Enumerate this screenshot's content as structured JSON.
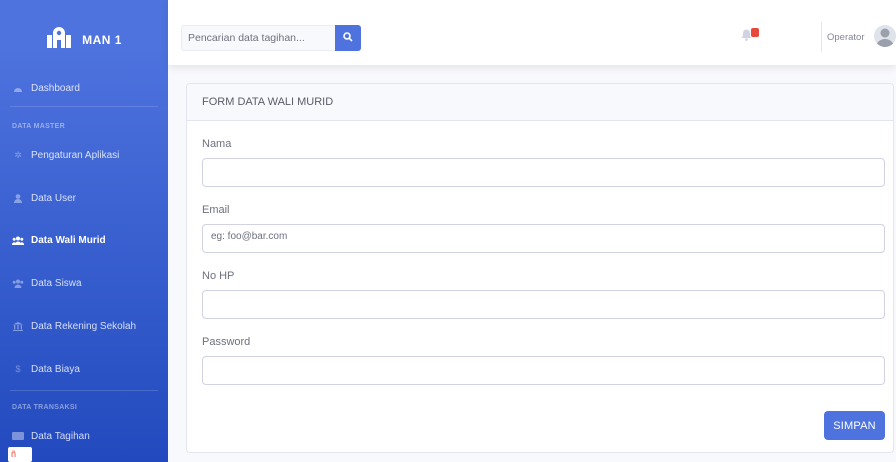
{
  "app": {
    "brand": "MAN 1"
  },
  "sidebar": {
    "dashboard": "Dashboard",
    "heading_master": "DATA MASTER",
    "items_master": [
      {
        "label": "Pengaturan Aplikasi",
        "icon": "gear-icon"
      },
      {
        "label": "Data User",
        "icon": "user-icon"
      },
      {
        "label": "Data Wali Murid",
        "icon": "users-icon",
        "active": true
      },
      {
        "label": "Data Siswa",
        "icon": "users-icon"
      },
      {
        "label": "Data Rekening Sekolah",
        "icon": "bank-icon"
      },
      {
        "label": "Data Biaya",
        "icon": "dollar-icon"
      }
    ],
    "heading_transaksi": "DATA TRANSAKSI",
    "items_transaksi": [
      {
        "label": "Data Tagihan",
        "icon": "invoice-icon"
      }
    ]
  },
  "topbar": {
    "search_placeholder": "Pencarian data tagihan...",
    "notification_count": "",
    "user_name": "Operator"
  },
  "form": {
    "title": "FORM DATA WALI MURID",
    "fields": [
      {
        "label": "Nama",
        "placeholder": ""
      },
      {
        "label": "Email",
        "placeholder": "eg: foo@bar.com"
      },
      {
        "label": "No HP",
        "placeholder": ""
      },
      {
        "label": "Password",
        "placeholder": ""
      }
    ],
    "submit_label": "SIMPAN"
  },
  "colors": {
    "primary": "#4e73df",
    "sidebar_dark": "#224abe",
    "danger": "#e74a3b"
  }
}
